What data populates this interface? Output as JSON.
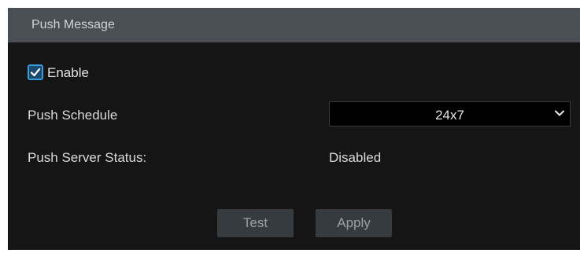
{
  "header": {
    "title": "Push Message"
  },
  "enable": {
    "label": "Enable",
    "checked": true,
    "accent_color": "#3a9bd8"
  },
  "push_schedule": {
    "label": "Push Schedule",
    "selected": "24x7"
  },
  "push_server_status": {
    "label": "Push Server Status:",
    "value": "Disabled"
  },
  "buttons": {
    "test": "Test",
    "apply": "Apply"
  },
  "icons": {
    "checkbox": "checkmark-icon",
    "dropdown": "chevron-down-icon"
  },
  "colors": {
    "panel_background": "#151515",
    "header_background": "#4a4f56",
    "button_background": "#363b40"
  }
}
